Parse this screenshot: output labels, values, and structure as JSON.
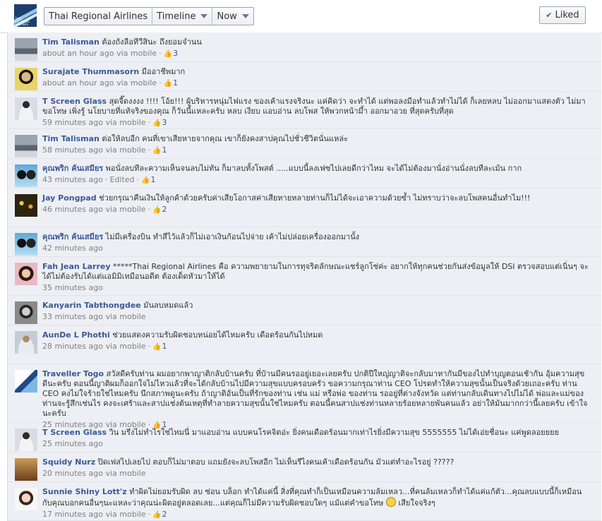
{
  "page": {
    "logo_text": "THAI REGIONAL AIRLINES",
    "breadcrumbs": [
      "Thai Regional Airlines",
      "Timeline",
      "Now"
    ],
    "liked_label": "Liked"
  },
  "comments": [
    {
      "name": "Tim Talisman",
      "text": "ต้องถังลือทีวีสินะ ถึงยอมจำนน",
      "meta": "about an hour ago via mobile",
      "likes": "3",
      "avatar": "skyline"
    },
    {
      "name": "Surajate Thummasorn",
      "text": "มืออาชีพมาก",
      "meta": "about an hour ago via mobile",
      "likes": "1",
      "avatar": "face-yellow"
    },
    {
      "name": "T Screen Glass",
      "text": "สุดจี๊ดงงงง !!!! โอ้ย!!! ผู้บริหารหนุ่มไฟแรง ของเค้าแรงจริงนะ แค่คิดว่า จะทำได้ แต่พอลงมือทำแล้วทำไม่ได้ ก็เลยหลบ ไม่ออกมาแสดงตัว ไม่มาขอโทษ เพิ่งรู้ นโยบายที่แท้จริงของคุณ ก็วันนี้แหละครับ หลบ เงียบ แอบอ่าน ลบโพส ให้พวกหน้ามึ้า ออกมาอวย ที่สุดครับที่สุด",
      "meta": "59 minutes ago via mobile",
      "likes": "3",
      "avatar": "person-white"
    },
    {
      "name": "Tim Talisman",
      "text": "ต่อให้ลบอีก คนที่เขาเสียหายจากคุณ เขาก็ยังคงสาปคุณไปชั่วชีวิตนั่นแหล่ะ",
      "meta": "58 minutes ago via mobile",
      "likes": "1",
      "avatar": "skyline"
    },
    {
      "name": "คุณพริก ค้นเสมียร",
      "text": "พอนั่งลบทีละความเห็นจนลบไม่ทัน ก็มาลบทั้งโพสต์ .....แบบนี้ลงเฟซไปเลยดีกว่าไหม จะได้ไม่ต้องมานั่งอ่านนั่งลบทีละเม้น กาก",
      "meta": "43 minutes ago",
      "extra": "Edited",
      "likes": "1",
      "avatar": "couple"
    },
    {
      "name": "Jay Pongpad",
      "text": "ช่วยกรุณาคืนเงินให้ลูกค้าด้วยครับค่าเสียโอกาสค่าเสียหายหลายท่านก็ไม่ได้จะเอาความด้วยซ้ำ ไม่ทราบว่าจะลบโพสคนอื่นทำไม!!!",
      "meta": "46 minutes ago via mobile",
      "likes": "2",
      "avatar": "night"
    },
    {
      "name": "คุณพริก ค้นเสมียร",
      "text": "ไม่มีเครื่องบิน ทำสีไว้แล้วก็ไม่เอาเงินก้อนไปจ่าย เค้าไม่ปล่อยเครื่องออกมานั้ง",
      "meta": "42 minutes ago",
      "avatar": "couple"
    },
    {
      "name": "Fah Jean Larrey",
      "text": "*****Thai Regional Airlines คือ ความพยายามในการทุจริตลักษณะแชร์ลูกโซ่ค่ะ อยากให้ทุกคนช่วยกันส่งข้อมูลให้ DSI ตรวจสอบแต่เนิ่นๆ จะได้ไม่ต้องรับได้แต่แอมิมิเหมือนอดีต ต้องเด็ดหัวมาให้ได้",
      "meta": "35 minutes ago",
      "avatar": "girl"
    },
    {
      "name": "Kanyarin Tabthongdee",
      "text": "มันลบหมดแล้ว",
      "meta": "33 minutes ago via mobile",
      "avatar": "bw"
    },
    {
      "name": "AunDe L Phothi",
      "text": "ช่วยแสดงความรับผิดชอบหน่อยได้ไหมครับ เดือดร้อนกันไปหมด",
      "meta": "28 minutes ago via mobile",
      "likes": "1",
      "avatar": "man"
    },
    {
      "name": "Traveller Togo",
      "text": "สวัสดีครับท่าน ผมอยากพาญาติกลับบ้านครับ ที่บ้านมีคนรออยู่เยอะเลยครับ ปกติปีใหญ่ญาติจะกลับมาหากันมีของไปทำบุญตอนเช้ากัน อุ้มความสุขดีนะครับ ตอนนี้ญาติผมก็ออกใจไม่ไหวแล้วที่จะได้กลับบ้านไปมีความสุขแบบครอบครัว ขอความกรุณาท่าน CEO โปรดทำให้ความสุขนั้นเป็นจริงด้วยเถอะครับ ท่าน CEO คงไม่ใจร้ายใช่ไหมครับ นึกสภาพดูนะครับ ถ้าญาติอันเป็นที่รักของท่าน เช่น แม่ หรือพ่อ ของท่าน รออยู่ที่ต่างจังหวัด แต่ท่านกลับเดินทางไปไม่ได้ พ่อและแม่ของท่านจะรู้สึกเช่นไร คงจะเศร้าและสาปแช่งต้นเหตุที่ทำลายความสุขนั้นใช่ไหมครับ ตอนนี้คนสาปแช่งท่านหลายร้อยหลายพันคนแล้ว อย่าให้มันมากกว่านี้เลยครับ เข้าใจนะครับ",
      "meta": "25 minutes ago via mobile",
      "likes": "1",
      "avatar": "logo"
    },
    {
      "name": "T Screen Glass",
      "text": "วิน มรึงไม่ทำไรใช่ไหมนี่ มาแอบอ่าน แบบคนโรคจิตอ่ะ ยิ่งคนเดือดร้อนมากเท่าไรยิ่งมีความสุข 5555555 ไม่ได้เอ่ยชื่อนะ แค่พูดลอยยยย",
      "meta": "25 minutes ago",
      "avatar": "person-white"
    },
    {
      "name": "Squidy Nurz",
      "text": "ปิดเฟสไปเลยไป ตอบก็ไม่มาตอบ แถมยังจะลบโพสอีก ไม่เห็นรึไงคนเค้าเดือดร้อนกัน มัวแต่ทำอะไรอยู่ ?????",
      "meta": "20 minutes ago via mobile",
      "avatar": "sunset"
    },
    {
      "name": "Sunnie Shiny Lott'z",
      "text": "ทำผิดไม่ยอมรับผิด ลบ ซ่อน บล็อก ทำได้แค่นี้ สิ่งที่คุณทำก็เป็นเหมือนความล้มเหลว...ที่คนล้มเหลวก็ทำได้แค่แก้ตัว...คุณลบแบบนี้ก็เหมือนกับคุณบอกคนอื่นๆนะแหละว่าคุณน่ะผิดอยู่ตลอดเลย...แต่คุณก็ไม่มีความรับผิดชอบใดๆ แม้แต่คำขอโทษ",
      "text_tail": "เสียใจจริงๆ",
      "meta": "17 minutes ago via mobile",
      "likes": "2",
      "avatar": "smile-girl"
    }
  ]
}
